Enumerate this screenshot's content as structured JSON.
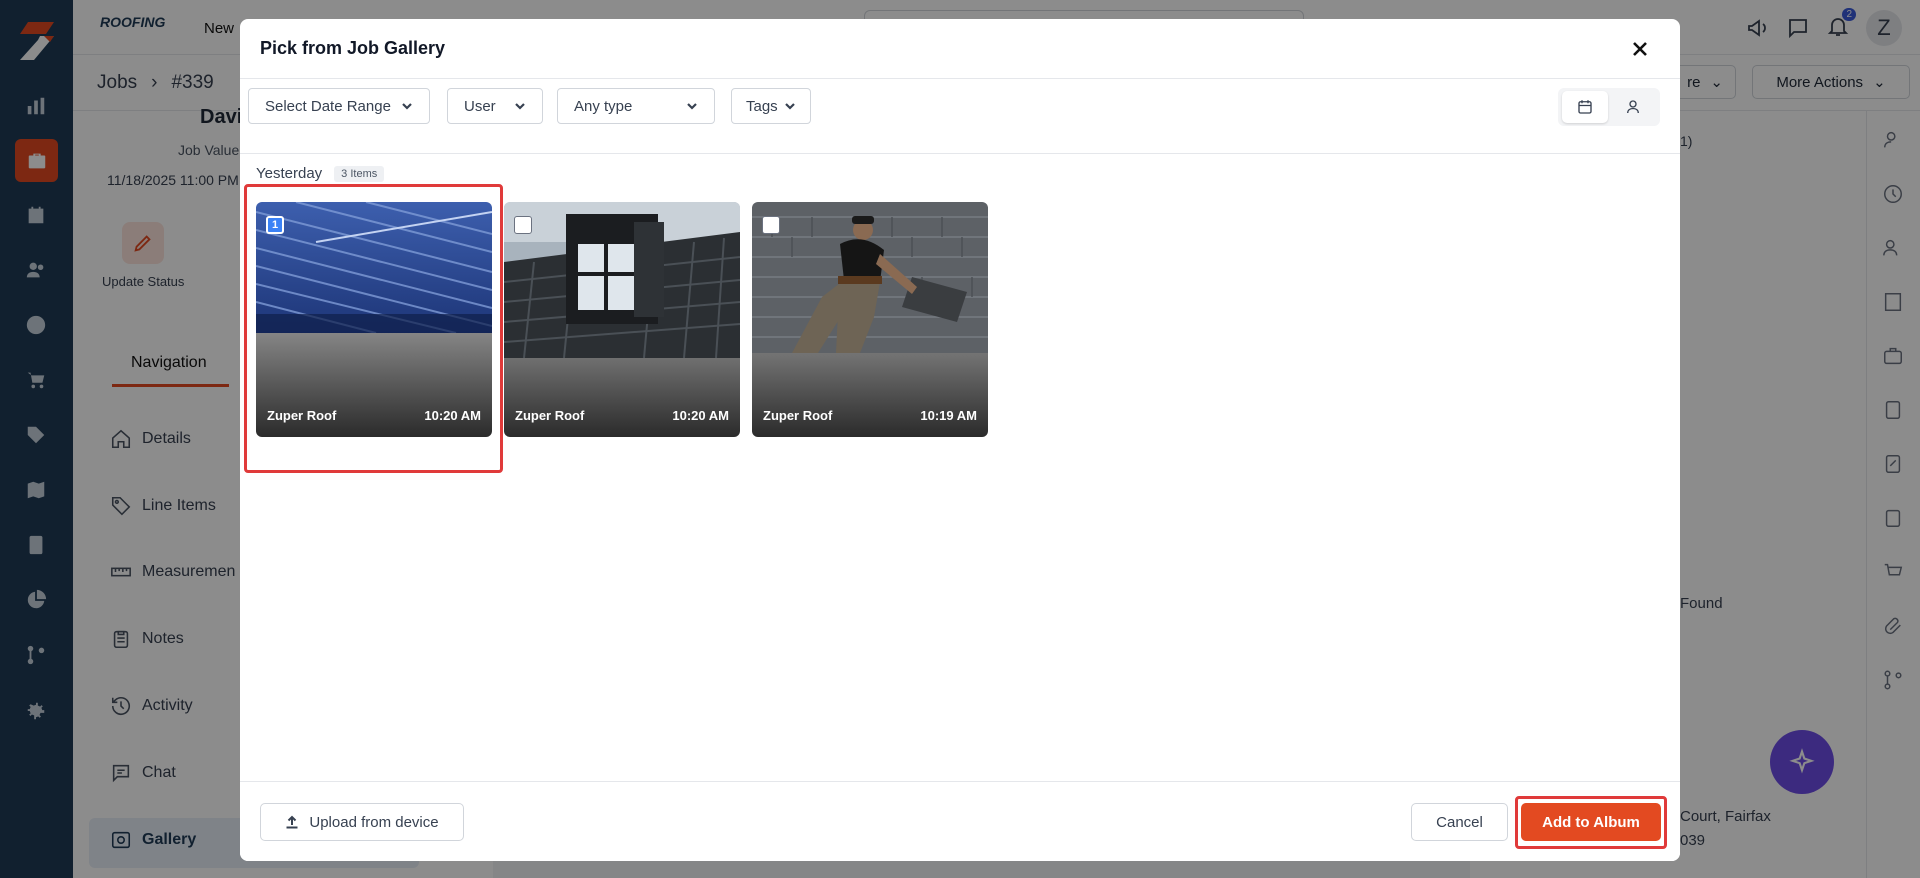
{
  "app": {
    "brand": "ROOFING",
    "new_label": "New",
    "notifications_count": "2",
    "avatar_initial": "Z"
  },
  "breadcrumb": {
    "root": "Jobs",
    "current": "#339"
  },
  "header_actions": {
    "more_actions_label": "More Actions",
    "partial_label": "re"
  },
  "job": {
    "name_partial": "Davi",
    "job_value_label": "Job Value",
    "datetime": "11/18/2025 11:00 PM",
    "update_status_label": "Update Status"
  },
  "left_nav": {
    "section_tab": "Navigation",
    "items": [
      {
        "label": "Details",
        "icon": "home-icon"
      },
      {
        "label": "Line Items",
        "icon": "tag-icon"
      },
      {
        "label": "Measuremen",
        "icon": "ruler-icon"
      },
      {
        "label": "Notes",
        "icon": "clipboard-icon"
      },
      {
        "label": "Activity",
        "icon": "history-icon"
      },
      {
        "label": "Chat",
        "icon": "chat-icon"
      },
      {
        "label": "Gallery",
        "icon": "gallery-icon"
      }
    ]
  },
  "right_panel": {
    "not_found_partial": "Found",
    "address_partial": "Court, Fairfax",
    "zip_partial": "039",
    "count_partial": "1)"
  },
  "modal": {
    "title": "Pick from Job Gallery",
    "filters": {
      "date_range": "Select Date Range",
      "user": "User",
      "type": "Any type",
      "tags": "Tags"
    },
    "section": {
      "label": "Yesterday",
      "count": "3 Items"
    },
    "photos": [
      {
        "title": "Zuper Roof",
        "time": "10:20 AM",
        "selected": true,
        "selection_index": "1",
        "subject": "blue metal roof"
      },
      {
        "title": "Zuper Roof",
        "time": "10:20 AM",
        "selected": false,
        "subject": "dormer window on tiled roof"
      },
      {
        "title": "Zuper Roof",
        "time": "10:19 AM",
        "selected": false,
        "subject": "worker repairing slate roof"
      }
    ],
    "footer": {
      "upload_label": "Upload from device",
      "cancel_label": "Cancel",
      "add_label": "Add to Album"
    }
  },
  "colors": {
    "brand_orange": "#e34a21",
    "sidebar_navy": "#1f3b57",
    "highlight_red": "#e03a3a",
    "selection_blue": "#3b82f6",
    "fab_purple": "#6d4ee8"
  }
}
